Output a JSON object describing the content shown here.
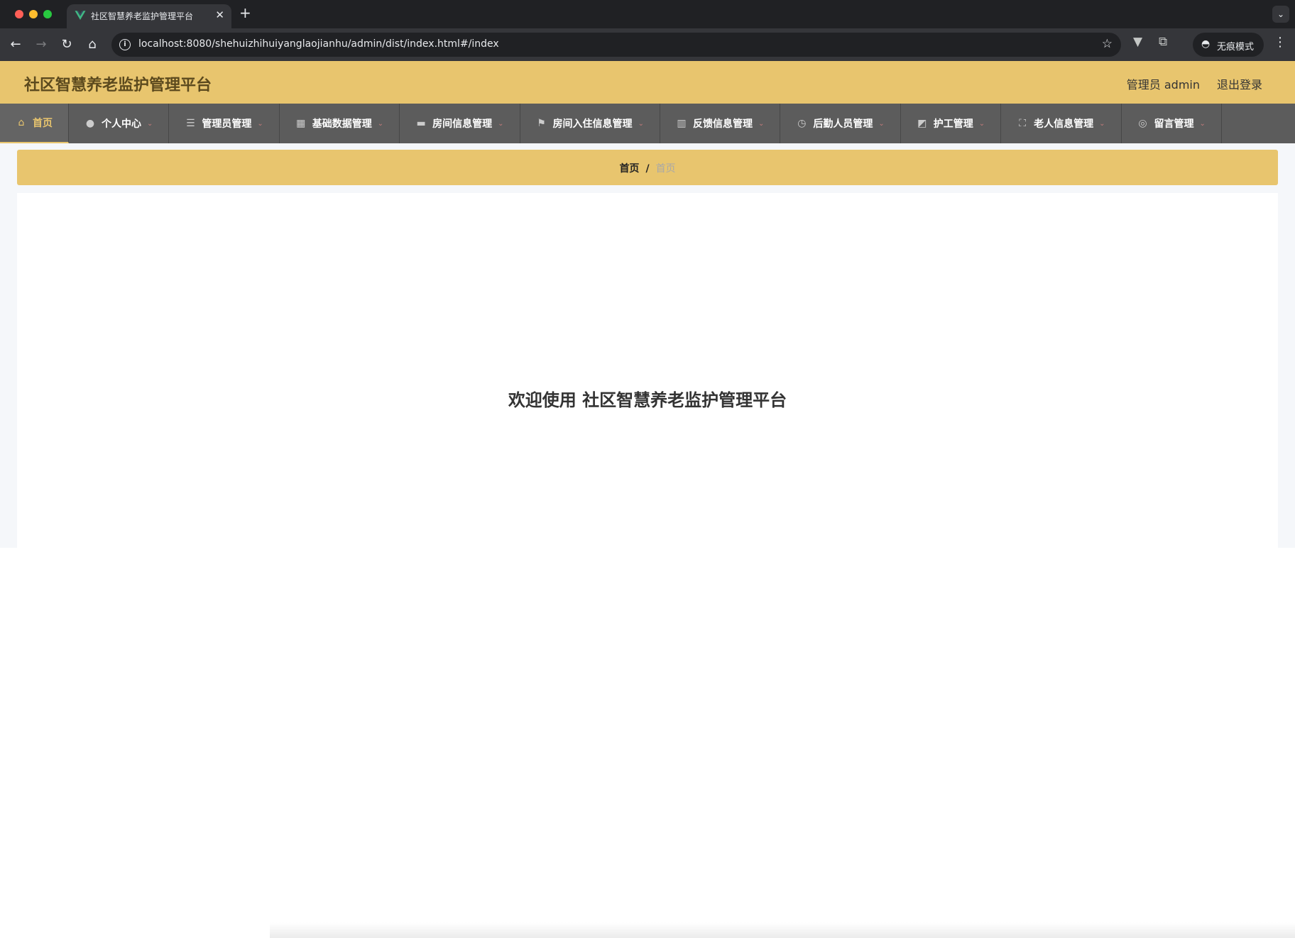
{
  "browser": {
    "tab_title": "社区智慧养老监护管理平台",
    "tab_close": "✕",
    "new_tab": "+",
    "url": "localhost:8080/shehuizhihuiyanglaojianhu/admin/dist/index.html#/index",
    "incognito_label": "无痕模式",
    "icons": {
      "back": "back-arrow-icon",
      "forward": "forward-arrow-icon",
      "reload": "reload-icon",
      "home": "home-icon",
      "site_info": "info-icon",
      "bookmark": "star-icon",
      "extension_vue": "vue-devtools-icon",
      "extensions": "puzzle-icon",
      "incognito": "incognito-icon",
      "menu": "more-vertical-icon"
    }
  },
  "app": {
    "title": "社区智慧养老监护管理平台",
    "user_label": "管理员 admin",
    "logout_label": "退出登录",
    "colors": {
      "header_bg": "#e8c56e",
      "menu_bg": "#5c5c5c",
      "accent": "#e8c56e"
    }
  },
  "menu": {
    "items": [
      {
        "label": "首页",
        "icon": "home-icon",
        "active": true,
        "dropdown": false
      },
      {
        "label": "个人中心",
        "icon": "user-icon",
        "active": false,
        "dropdown": true
      },
      {
        "label": "管理员管理",
        "icon": "list-icon",
        "active": false,
        "dropdown": true
      },
      {
        "label": "基础数据管理",
        "icon": "grid-icon",
        "active": false,
        "dropdown": true
      },
      {
        "label": "房间信息管理",
        "icon": "briefcase-icon",
        "active": false,
        "dropdown": true
      },
      {
        "label": "房间入住信息管理",
        "icon": "flag-icon",
        "active": false,
        "dropdown": true
      },
      {
        "label": "反馈信息管理",
        "icon": "building-icon",
        "active": false,
        "dropdown": true
      },
      {
        "label": "后勤人员管理",
        "icon": "clock-icon",
        "active": false,
        "dropdown": true
      },
      {
        "label": "护工管理",
        "icon": "chart-icon",
        "active": false,
        "dropdown": true
      },
      {
        "label": "老人信息管理",
        "icon": "fullscreen-icon",
        "active": false,
        "dropdown": true
      },
      {
        "label": "留言管理",
        "icon": "target-icon",
        "active": false,
        "dropdown": true
      }
    ]
  },
  "breadcrumb": {
    "home": "首页",
    "separator": "/",
    "current": "首页"
  },
  "main": {
    "welcome": "欢迎使用 社区智慧养老监护管理平台"
  }
}
